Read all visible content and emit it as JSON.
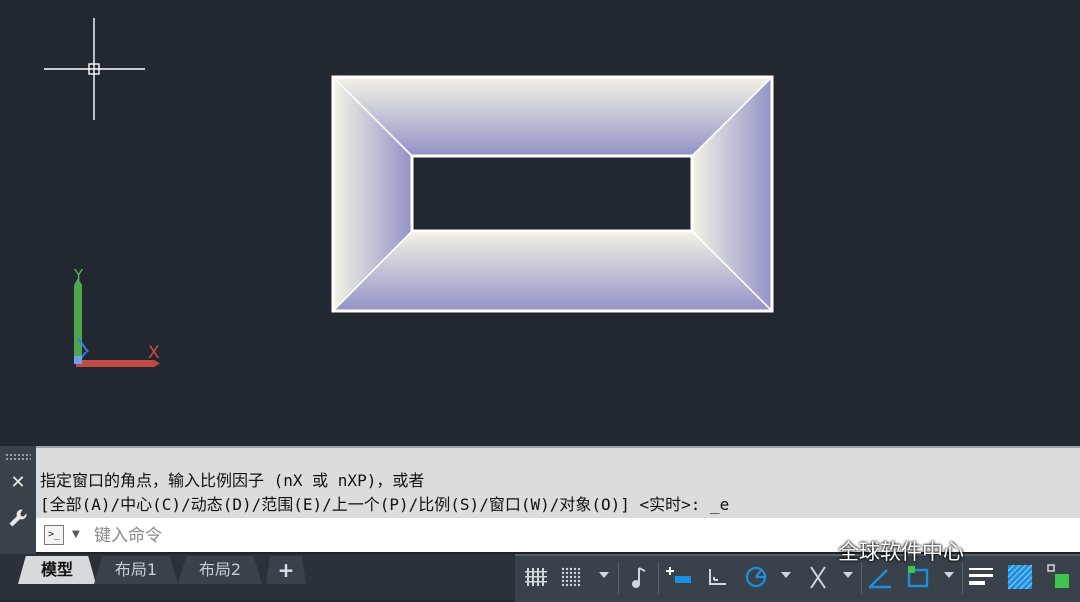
{
  "command_history": {
    "line1": "指定窗口的角点，输入比例因子 (nX 或 nXP)，或者",
    "line2": "[全部(A)/中心(C)/动态(D)/范围(E)/上一个(P)/比例(S)/窗口(W)/对象(O)] <实时>: _e"
  },
  "command_input": {
    "placeholder": "键入命令",
    "prompt_icon": ">_"
  },
  "ucs": {
    "x_label": "X",
    "y_label": "Y"
  },
  "tabs": [
    {
      "label": "模型",
      "active": true
    },
    {
      "label": "布局1",
      "active": false
    },
    {
      "label": "布局2",
      "active": false
    },
    {
      "label": "+",
      "active": false
    }
  ],
  "panel_controls": {
    "close_symbol": "✕"
  },
  "status_bar_icons": [
    "grid-display-icon",
    "snap-mode-icon",
    "infer-constraints-icon",
    "dynamic-input-icon",
    "ortho-mode-icon",
    "polar-tracking-icon",
    "isometric-drafting-icon",
    "object-snap-tracking-icon",
    "object-snap-icon",
    "lineweight-icon",
    "transparency-icon",
    "selection-cycling-icon"
  ],
  "watermark": "全球软件中心",
  "colors": {
    "canvas_bg": "#212830",
    "shape_outline": "#ffffff",
    "gradient_light": "#f2f2e2",
    "gradient_dark": "#8f8fc6",
    "ucs_x": "#c9504a",
    "ucs_y": "#5cb35a",
    "status_accent": "#1c8fe0"
  }
}
